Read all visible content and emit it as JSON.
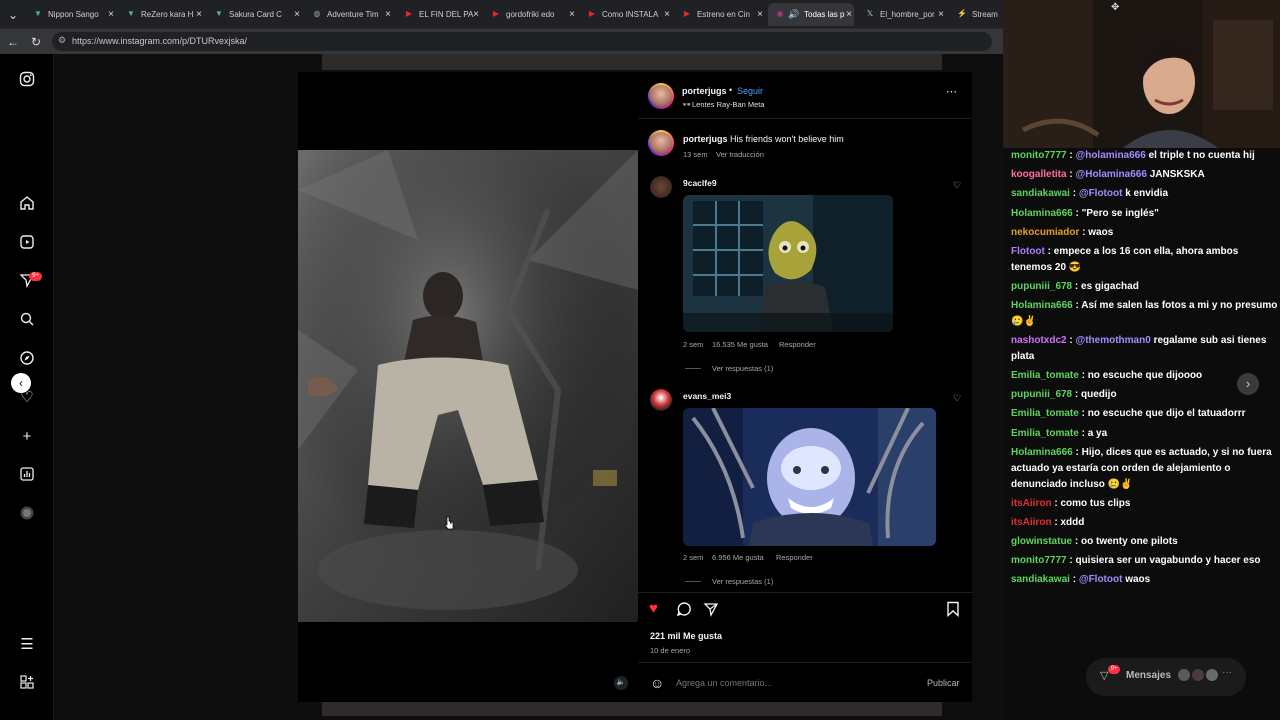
{
  "browser": {
    "tabs": [
      {
        "label": "Nippon Sango",
        "color": "#3fbf6f",
        "icon": "v-logo"
      },
      {
        "label": "ReZero kara H",
        "color": "#3fbf6f",
        "icon": "v-logo"
      },
      {
        "label": "Sakura Card C",
        "color": "#3fbf6f",
        "icon": "v-logo"
      },
      {
        "label": "Adventure Tim",
        "color": "#9aa0a6",
        "icon": "globe"
      },
      {
        "label": "EL FIN DEL PA",
        "color": "#e02a2a",
        "icon": "play"
      },
      {
        "label": "gordofriki edo",
        "color": "#e02a2a",
        "icon": "play"
      },
      {
        "label": "Como INSTALA",
        "color": "#e02a2a",
        "icon": "play"
      },
      {
        "label": "Estreno en Cin",
        "color": "#e02a2a",
        "icon": "play"
      },
      {
        "label": "Todas las p",
        "color": "#c13584",
        "icon": "instagram"
      },
      {
        "label": "El_hombre_por",
        "color": "#cccccc",
        "icon": "x"
      },
      {
        "label": "Stream",
        "color": "#3fbf6f",
        "icon": "s"
      }
    ],
    "url": "https://www.instagram.com/p/DTURvexjska/"
  },
  "post": {
    "author": "porterjugs",
    "follow_label": "Seguir",
    "subtitle": "Lentes Ray-Ban Meta",
    "caption_user": "porterjugs",
    "caption_text": "His friends won't believe him",
    "caption_age": "13 sem",
    "translate_label": "Ver traducción",
    "comments": [
      {
        "user": "9caclfe9",
        "age": "2 sem",
        "likes": "16.535 Me gusta",
        "reply": "Responder",
        "replies": "Ver respuestas (1)"
      },
      {
        "user": "evans_mei3",
        "age": "2 sem",
        "likes": "6.956 Me gusta",
        "reply": "Responder",
        "replies": "Ver respuestas (1)"
      }
    ],
    "likes": "221 mil Me gusta",
    "date": "10 de enero",
    "comment_placeholder": "Agrega un comentario...",
    "publish_label": "Publicar",
    "notif_count": "9+",
    "liked": true
  },
  "chat": [
    {
      "user": "monito7777",
      "color": "#5fd35f",
      "mention": "@holamina666",
      "text": "el triple t no cuenta hij"
    },
    {
      "user": "koogalletita",
      "color": "#ff6ea0",
      "mention": "@Holamina666",
      "text": "JANSKSKA"
    },
    {
      "user": "sandiakawai",
      "color": "#5fd35f",
      "mention": "@Flotoot",
      "text": "k envidia"
    },
    {
      "user": "Holamina666",
      "color": "#5fd35f",
      "mention": "",
      "text": "\"Pero se inglés\""
    },
    {
      "user": "nekocumiador",
      "color": "#e0a030",
      "mention": "",
      "text": "waos"
    },
    {
      "user": "Flotoot",
      "color": "#b27cff",
      "mention": "",
      "text": "empece a los 16 con ella, ahora ambos tenemos 20 😎"
    },
    {
      "user": "pupuniii_678",
      "color": "#5fd35f",
      "mention": "",
      "text": "es gigachad"
    },
    {
      "user": "Holamina666",
      "color": "#5fd35f",
      "mention": "",
      "text": "Así me salen las fotos a mi y no presumo 🥲✌"
    },
    {
      "user": "nashotxdc2",
      "color": "#d070ff",
      "mention": "@themothman0",
      "text": "regalame sub asi tienes plata"
    },
    {
      "user": "Emilia_tomate",
      "color": "#5fd35f",
      "mention": "",
      "text": "no escuche que dijoooo"
    },
    {
      "user": "pupuniii_678",
      "color": "#5fd35f",
      "mention": "",
      "text": "quedijo"
    },
    {
      "user": "Emilia_tomate",
      "color": "#5fd35f",
      "mention": "",
      "text": "no escuche que dijo el tatuadorrr"
    },
    {
      "user": "Emilia_tomate",
      "color": "#5fd35f",
      "mention": "",
      "text": "a ya"
    },
    {
      "user": "Holamina666",
      "color": "#5fd35f",
      "mention": "",
      "text": "Hijo, dices que es actuado, y si no fuera actuado ya estaría con orden de alejamiento o denunciado incluso 🥲✌"
    },
    {
      "user": "itsAiiron",
      "color": "#e03030",
      "mention": "",
      "text": "como tus clips"
    },
    {
      "user": "itsAiiron",
      "color": "#e03030",
      "mention": "",
      "text": "xddd"
    },
    {
      "user": "glowinstatue",
      "color": "#5fd35f",
      "mention": "",
      "text": "oo twenty one pilots"
    },
    {
      "user": "monito7777",
      "color": "#5fd35f",
      "mention": "",
      "text": "quisiera ser un vagabundo y hacer eso"
    },
    {
      "user": "sandiakawai",
      "color": "#5fd35f",
      "mention": "@Flotoot",
      "text": "waos"
    }
  ],
  "dm": {
    "label": "Mensajes",
    "count": "9+"
  }
}
